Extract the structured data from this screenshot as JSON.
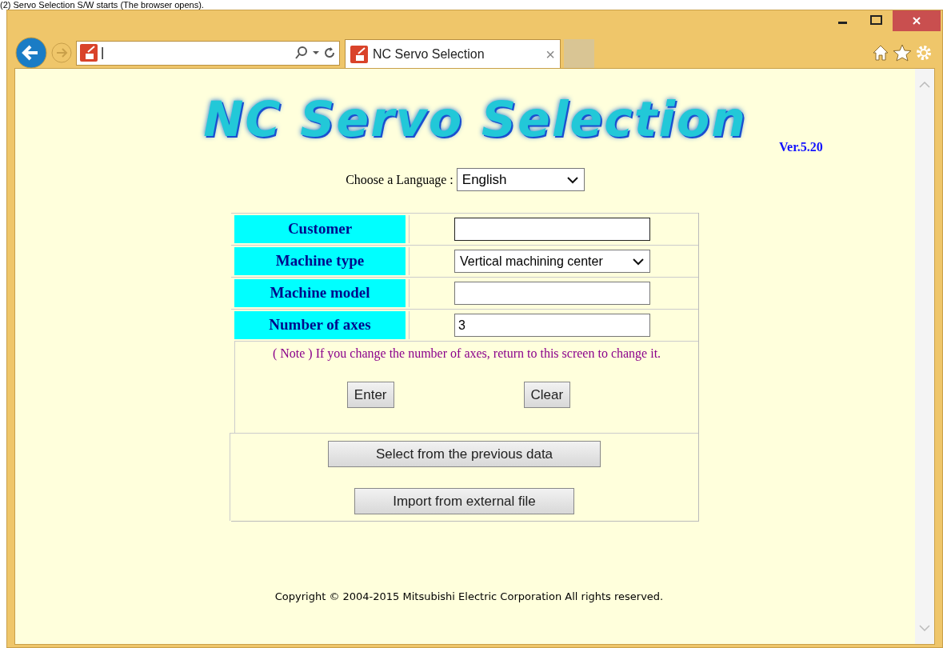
{
  "caption": "(2) Servo Selection S/W starts (The browser opens).",
  "browser": {
    "address": {
      "value": "|"
    },
    "tab": {
      "title": "NC Servo Selection",
      "close": "×"
    }
  },
  "page": {
    "logo": "NC Servo Selection",
    "version": "Ver.5.20",
    "language": {
      "label": "Choose a Language :",
      "value": "English"
    },
    "fields": [
      {
        "label": "Customer",
        "kind": "text"
      },
      {
        "label": "Machine type",
        "kind": "select",
        "value": "Vertical machining center"
      },
      {
        "label": "Machine model",
        "kind": "text"
      },
      {
        "label": "Number of axes",
        "kind": "text",
        "value": "3"
      }
    ],
    "note": "( Note ) If you change the number of axes, return to this screen to change it.",
    "buttons": [
      "Enter",
      "Clear"
    ],
    "actions": [
      "Select from the previous data",
      "Import from external file"
    ],
    "copyright": "Copyright © 2004-2015 Mitsubishi Electric Corporation All rights reserved."
  }
}
